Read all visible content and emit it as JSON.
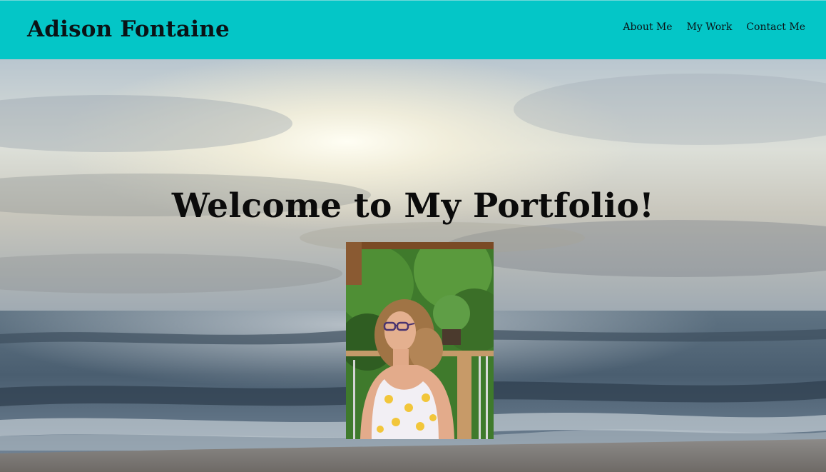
{
  "site": {
    "brand": "Adison Fontaine",
    "nav": [
      "About Me",
      "My Work",
      "Contact Me"
    ],
    "accent_color": "#04c6c7"
  },
  "hero": {
    "title": "Welcome to My Portfolio!",
    "background": "ocean-sunset-photo",
    "portrait": "profile-photo"
  }
}
